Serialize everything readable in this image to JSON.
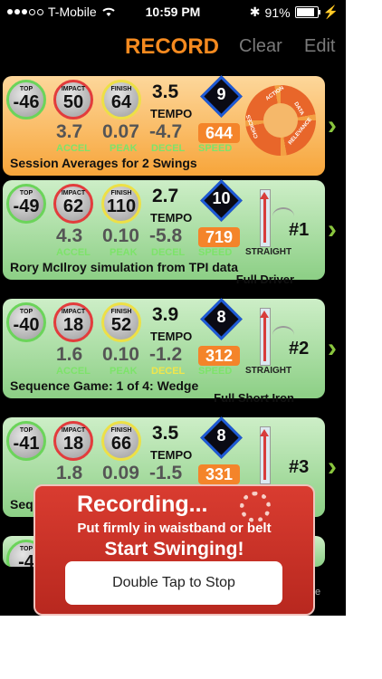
{
  "status": {
    "carrier": "T-Mobile",
    "time": "10:59 PM",
    "battery": "91%"
  },
  "nav": {
    "title": "RECORD",
    "clear": "Clear",
    "edit": "Edit"
  },
  "labels": {
    "top": "TOP",
    "impact": "IMPACT",
    "finish": "FINISH",
    "tempo": "TEMPO",
    "accel": "ACCEL",
    "peak": "PEAK",
    "decel": "DECEL",
    "speed": "SPEED",
    "straight": "STRAIGHT"
  },
  "cycle_words": [
    "ACTION",
    "DATA",
    "RELEVANCE",
    "CHOICES"
  ],
  "cards": [
    {
      "top": "-46",
      "impact": "50",
      "finish": "64",
      "tempo": "3.5",
      "score": "9",
      "accel": "3.7",
      "peak": "0.07",
      "decel": "-4.7",
      "speed": "644",
      "title": "Session Averages for 2 Swings"
    },
    {
      "top": "-49",
      "impact": "62",
      "finish": "110",
      "tempo": "2.7",
      "score": "10",
      "accel": "4.3",
      "peak": "0.10",
      "decel": "-5.8",
      "speed": "719",
      "swing": "#1",
      "title": "Rory McIlroy simulation from TPI data",
      "subtitle": "Full Driver"
    },
    {
      "top": "-40",
      "impact": "18",
      "finish": "52",
      "tempo": "3.9",
      "score": "8",
      "accel": "1.6",
      "peak": "0.10",
      "decel": "-1.2",
      "speed": "312",
      "swing": "#2",
      "title": "Sequence Game: 1 of 4: Wedge",
      "subtitle": "Full Short Iron"
    },
    {
      "top": "-41",
      "impact": "18",
      "finish": "66",
      "tempo": "3.5",
      "score": "8",
      "accel": "1.8",
      "peak": "0.09",
      "decel": "-1.5",
      "speed": "331",
      "swing": "#3",
      "title": "Sequence"
    },
    {
      "top": "-4"
    }
  ],
  "overlay": {
    "recording": "Recording...",
    "instruction": "Put firmly in waistband or belt",
    "start": "Start Swinging!",
    "stop": "Double Tap to Stop"
  },
  "colors": {
    "accent": "#f58a1f",
    "top_ring": "#6bd45a",
    "impact_ring": "#e23c3c",
    "finish_ring": "#ede046",
    "speed_box": "#f4842a",
    "overlay": "#c7342a",
    "chevron": "#8ac63e"
  }
}
